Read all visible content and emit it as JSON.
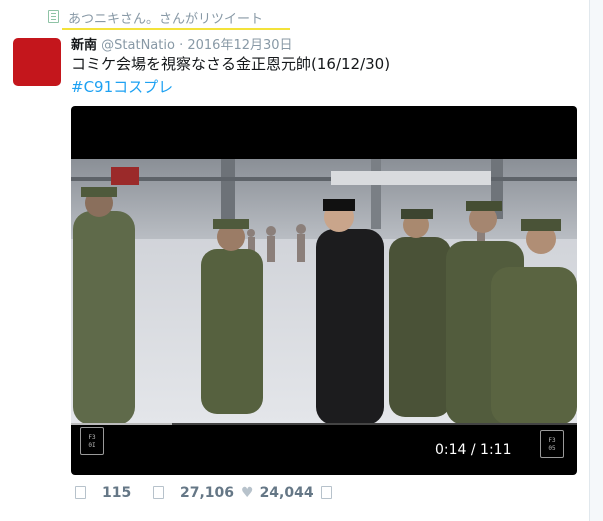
{
  "retweet": {
    "text": "あつニキさん。さんがリツイート"
  },
  "tweet": {
    "name": "新南",
    "handle": "@StatNatio",
    "separator": "·",
    "date": "2016年12月30日",
    "text": "コミケ会場を視察なさる金正恩元帥(16/12/30)",
    "hashtag": "#C91コスプレ"
  },
  "video": {
    "time": "0:14 / 1:11",
    "progress": 0.2,
    "left_button_glyph": "F3\n0I",
    "right_button_glyph": "F3\n05"
  },
  "actions": {
    "reply_count": "115",
    "retweet_count": "27,106",
    "like_count": "24,044"
  },
  "colors": {
    "accent": "#1da1f2",
    "avatar": "#c4161c",
    "highlight": "#f3e23a"
  }
}
